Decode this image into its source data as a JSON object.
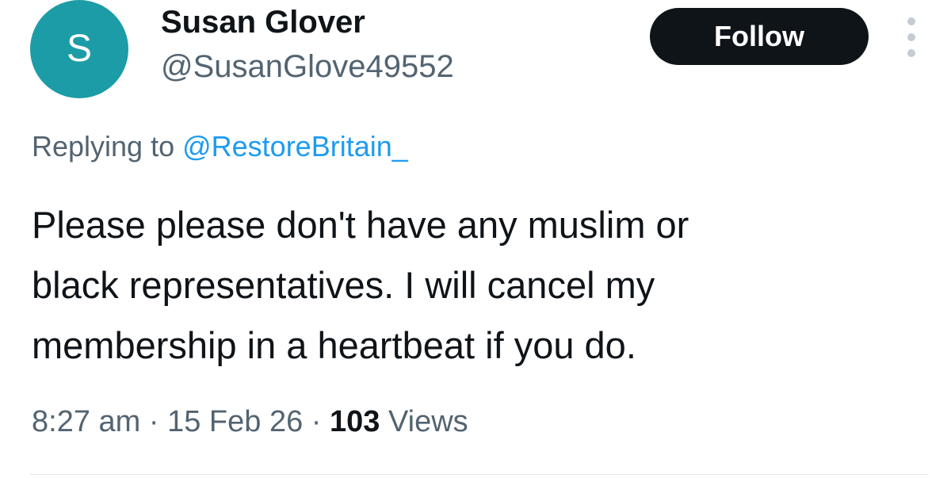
{
  "author": {
    "avatar_letter": "S",
    "avatar_color": "#1c9ca6",
    "display_name": "Susan Glover",
    "handle": "@SusanGlove49552"
  },
  "actions": {
    "follow_label": "Follow",
    "more_icon": "more-vertical-icon"
  },
  "reply": {
    "prefix": "Replying to ",
    "target": "@RestoreBritain_"
  },
  "tweet": {
    "lines": [
      "Please please don't have any muslim or",
      "black representatives. I will cancel my",
      "membership in a heartbeat if you do."
    ]
  },
  "meta": {
    "time": "8:27 am",
    "separator": " · ",
    "date": "15 Feb 26",
    "views_count": "103",
    "views_label": " Views"
  },
  "colors": {
    "text": "#0f1419",
    "secondary": "#536471",
    "link": "#1d9bf0",
    "button_bg": "#0f1419"
  }
}
